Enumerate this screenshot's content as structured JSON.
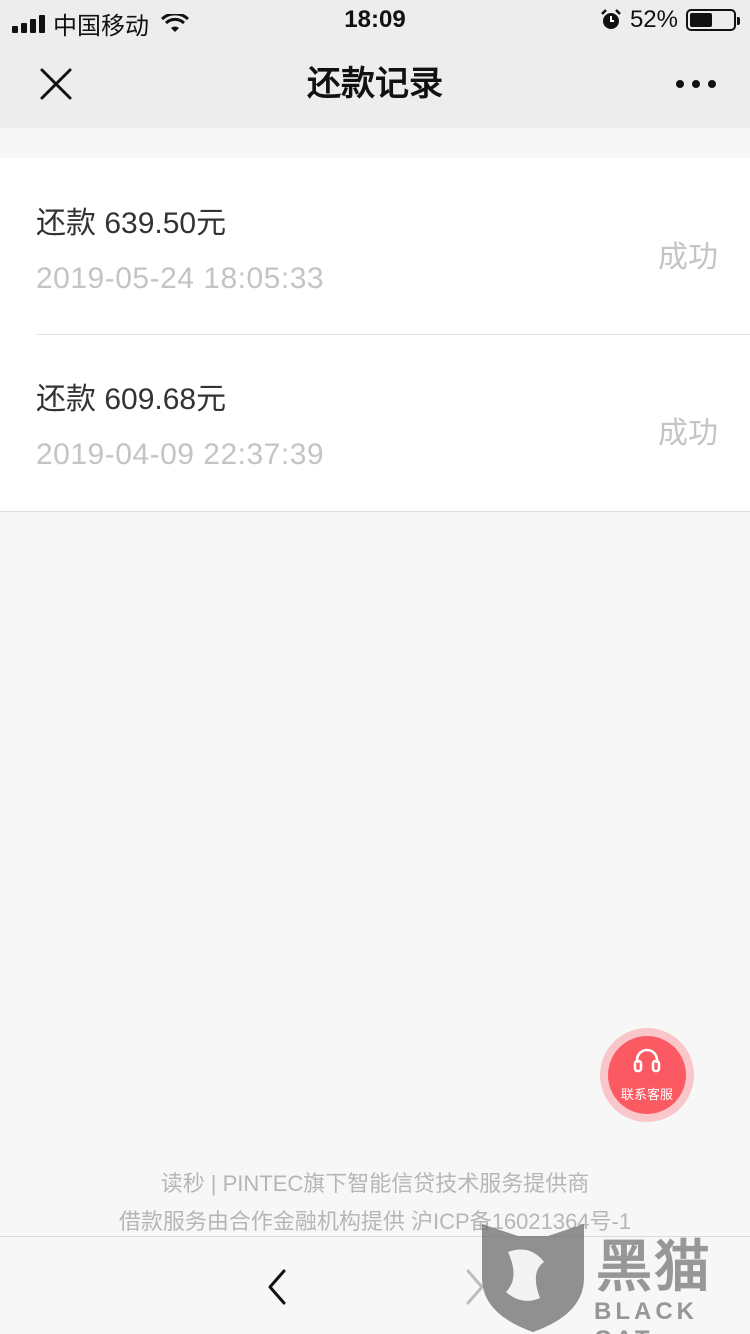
{
  "status_bar": {
    "carrier": "中国移动",
    "time": "18:09",
    "battery_text": "52%",
    "battery_level": 0.52
  },
  "nav": {
    "title": "还款记录"
  },
  "records": [
    {
      "title": "还款 639.50元",
      "time": "2019-05-24 18:05:33",
      "status": "成功"
    },
    {
      "title": "还款 609.68元",
      "time": "2019-04-09 22:37:39",
      "status": "成功"
    }
  ],
  "service_button": {
    "label": "联系客服",
    "color": "#fc5a63"
  },
  "footer": {
    "line1": "读秒 | PINTEC旗下智能信贷技术服务提供商",
    "line2": "借款服务由合作金融机构提供 沪ICP备16021364号-1"
  },
  "watermark": {
    "cn": "黑猫",
    "en": "BLACK CAT"
  }
}
